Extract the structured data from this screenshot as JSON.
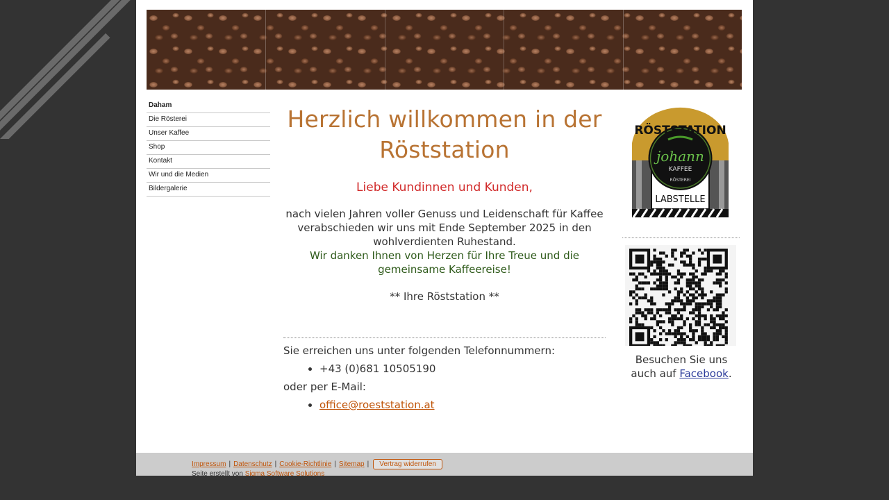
{
  "nav": {
    "items": [
      {
        "label": "Daham",
        "active": true
      },
      {
        "label": "Die Rösterei",
        "active": false
      },
      {
        "label": "Unser Kaffee",
        "active": false
      },
      {
        "label": "Shop",
        "active": false
      },
      {
        "label": "Kontakt",
        "active": false
      },
      {
        "label": "Wir und die Medien",
        "active": false
      },
      {
        "label": "Bildergalerie",
        "active": false
      }
    ]
  },
  "main": {
    "title_line1": "Herzlich willkommen in der",
    "title_line2": "Röststation",
    "greeting": "Liebe Kundinnen und Kunden,",
    "body": "nach vielen Jahren voller Genuss und Leidenschaft für Kaffee verabschieden wir uns mit Ende September 2025 in den wohlverdienten Ruhestand.",
    "thanks": "Wir danken Ihnen von Herzen für Ihre Treue und die gemeinsame Kaffeereise!",
    "signature": "** Ihre Röststation **",
    "phone_intro": "Sie erreichen uns unter folgenden Telefonnummern:",
    "phone": "+43 (0)681 10505190",
    "email_intro": "oder per E-Mail:",
    "email": "office@roeststation.at"
  },
  "sidebar": {
    "logo_top": "RÖSTSTATION",
    "logo_name": "johann",
    "logo_kaffee": "KAFFEE",
    "logo_roesterei": "RÖSTEREI",
    "logo_bottom": "LABSTELLE",
    "visit_text": "Besuchen Sie uns auch auf",
    "facebook_label": "Facebook",
    "visit_end": "."
  },
  "footer": {
    "impressum": "Impressum",
    "datenschutz": "Datenschutz",
    "cookie": "Cookie-Richtlinie",
    "sitemap": "Sitemap",
    "separator": "|",
    "revoke": "Vertrag widerrufen",
    "credit_prefix": "Seite erstellt von",
    "credit_link": "Sigma Software Solutions"
  },
  "colors": {
    "background": "#333333",
    "title": "#b87333",
    "greeting": "#d12a2a",
    "thanks": "#2e5a1a",
    "link": "#c0550a",
    "facebook_link": "#2a3a9a"
  }
}
